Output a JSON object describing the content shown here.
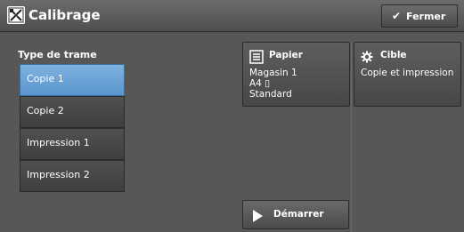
{
  "window": {
    "title": "Calibrage",
    "close_label": "Fermer"
  },
  "screen_type": {
    "label": "Type de trame",
    "items": [
      {
        "label": "Copie 1",
        "selected": true
      },
      {
        "label": "Copie 2",
        "selected": false
      },
      {
        "label": "Impression 1",
        "selected": false
      },
      {
        "label": "Impression 2",
        "selected": false
      }
    ]
  },
  "paper": {
    "title": "Papier",
    "tray": "Magasin 1",
    "size": "A4 ▯",
    "type": "Standard"
  },
  "target": {
    "title": "Cible",
    "value": "Copie et impression"
  },
  "start": {
    "label": "Démarrer"
  },
  "colors": {
    "selected": "#6aa4d8",
    "background": "#575757"
  }
}
